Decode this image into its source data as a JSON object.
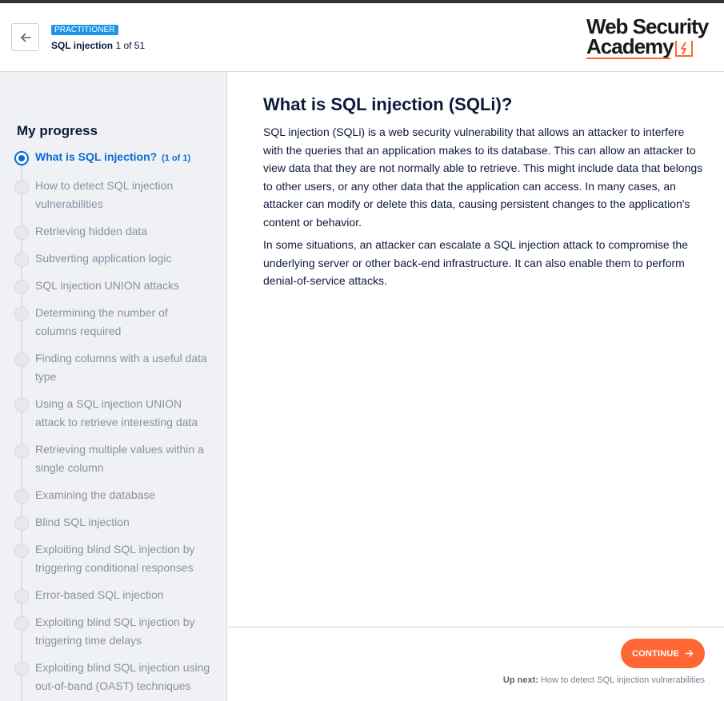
{
  "header": {
    "level_badge": "PRACTITIONER",
    "topic_name": "SQL injection",
    "topic_position": " 1 of 51",
    "logo_line1": "Web Security",
    "logo_line2": "Academy",
    "accent_color": "#ff6633"
  },
  "sidebar": {
    "title": "My progress",
    "items": [
      {
        "label": "What is SQL injection?",
        "count": "(1 of 1)",
        "active": true
      },
      {
        "label": "How to detect SQL injection vulnerabilities"
      },
      {
        "label": "Retrieving hidden data"
      },
      {
        "label": "Subverting application logic"
      },
      {
        "label": "SQL injection UNION attacks"
      },
      {
        "label": "Determining the number of columns required"
      },
      {
        "label": "Finding columns with a useful data type"
      },
      {
        "label": "Using a SQL injection UNION attack to retrieve interesting data"
      },
      {
        "label": "Retrieving multiple values within a single column"
      },
      {
        "label": "Examining the database"
      },
      {
        "label": "Blind SQL injection"
      },
      {
        "label": "Exploiting blind SQL injection by triggering conditional responses"
      },
      {
        "label": "Error-based SQL injection"
      },
      {
        "label": "Exploiting blind SQL injection by triggering time delays"
      },
      {
        "label": "Exploiting blind SQL injection using out-of-band (OAST) techniques"
      }
    ]
  },
  "main": {
    "title": "What is SQL injection (SQLi)?",
    "paragraphs": [
      "SQL injection (SQLi) is a web security vulnerability that allows an attacker to interfere with the queries that an application makes to its database. This can allow an attacker to view data that they are not normally able to retrieve. This might include data that belongs to other users, or any other data that the application can access. In many cases, an attacker can modify or delete this data, causing persistent changes to the application's content or behavior.",
      "In some situations, an attacker can escalate a SQL injection attack to compromise the underlying server or other back-end infrastructure. It can also enable them to perform denial-of-service attacks."
    ]
  },
  "footer": {
    "continue_label": "CONTINUE",
    "up_next_label": "Up next:",
    "up_next_text": "How to detect SQL injection vulnerabilities"
  }
}
